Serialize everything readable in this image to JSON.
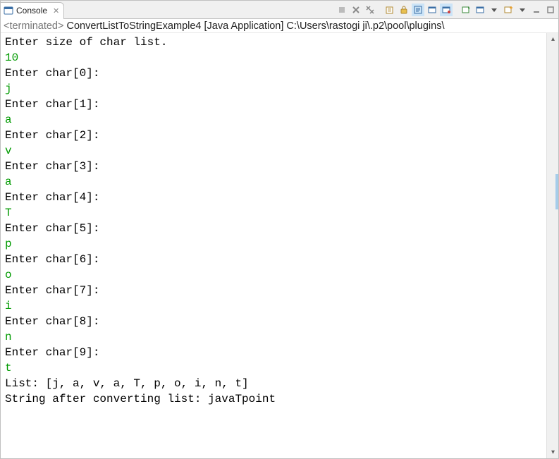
{
  "tab": {
    "title": "Console",
    "close_x": "✕"
  },
  "status": {
    "prefix": "<terminated>",
    "name": "ConvertListToStringExample4",
    "type": "[Java Application]",
    "path": "C:\\Users\\rastogi ji\\.p2\\pool\\plugins\\"
  },
  "output": {
    "lines": [
      {
        "t": "Enter size of char list.",
        "k": "out"
      },
      {
        "t": "10",
        "k": "in"
      },
      {
        "t": "Enter char[0]:",
        "k": "out"
      },
      {
        "t": "j",
        "k": "in"
      },
      {
        "t": "Enter char[1]:",
        "k": "out"
      },
      {
        "t": "a",
        "k": "in"
      },
      {
        "t": "Enter char[2]:",
        "k": "out"
      },
      {
        "t": "v",
        "k": "in"
      },
      {
        "t": "Enter char[3]:",
        "k": "out"
      },
      {
        "t": "a",
        "k": "in"
      },
      {
        "t": "Enter char[4]:",
        "k": "out"
      },
      {
        "t": "T",
        "k": "in"
      },
      {
        "t": "Enter char[5]:",
        "k": "out"
      },
      {
        "t": "p",
        "k": "in"
      },
      {
        "t": "Enter char[6]:",
        "k": "out"
      },
      {
        "t": "o",
        "k": "in"
      },
      {
        "t": "Enter char[7]:",
        "k": "out"
      },
      {
        "t": "i",
        "k": "in"
      },
      {
        "t": "Enter char[8]:",
        "k": "out"
      },
      {
        "t": "n",
        "k": "in"
      },
      {
        "t": "Enter char[9]:",
        "k": "out"
      },
      {
        "t": "t",
        "k": "in"
      },
      {
        "t": "List: [j, a, v, a, T, p, o, i, n, t]",
        "k": "out"
      },
      {
        "t": "String after converting list: javaTpoint",
        "k": "out"
      }
    ]
  }
}
